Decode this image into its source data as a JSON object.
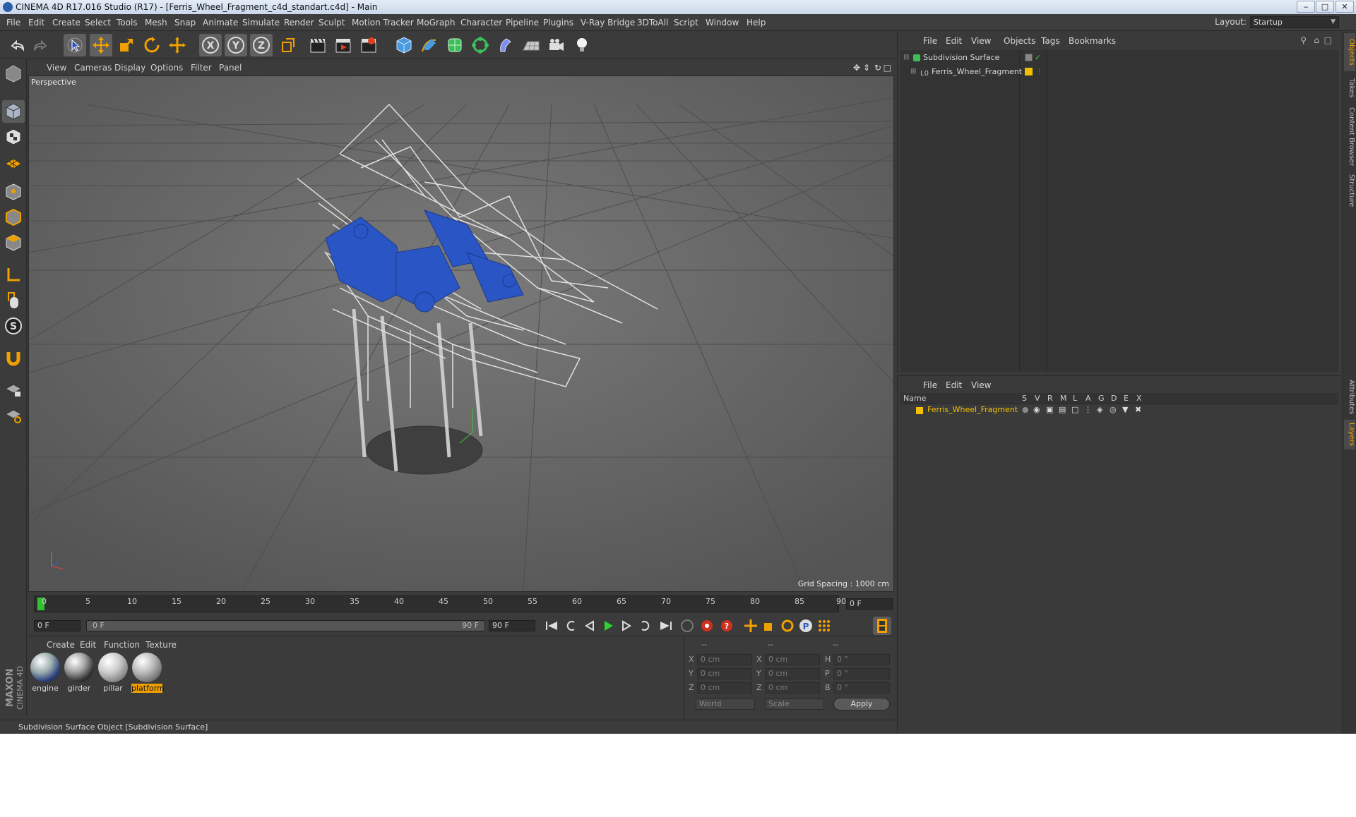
{
  "window": {
    "title": "CINEMA 4D R17.016 Studio (R17) - [Ferris_Wheel_Fragment_c4d_standart.c4d] - Main",
    "minimize": "‒",
    "maximize": "□",
    "close": "✕"
  },
  "menubar": {
    "items": [
      "File",
      "Edit",
      "Create",
      "Select",
      "Tools",
      "Mesh",
      "Snap",
      "Animate",
      "Simulate",
      "Render",
      "Sculpt",
      "Motion Tracker",
      "MoGraph",
      "Character",
      "Pipeline",
      "Plugins",
      "V-Ray Bridge",
      "3DToAll",
      "Script",
      "Window",
      "Help"
    ],
    "layout_label": "Layout:",
    "layout_value": "Startup"
  },
  "viewport": {
    "menu": [
      "View",
      "Cameras",
      "Display",
      "Options",
      "Filter",
      "Panel"
    ],
    "camera_label": "Perspective",
    "grid_spacing": "Grid Spacing : 1000 cm"
  },
  "timeline": {
    "ticks": [
      "0",
      "5",
      "10",
      "15",
      "20",
      "25",
      "30",
      "35",
      "40",
      "45",
      "50",
      "55",
      "60",
      "65",
      "70",
      "75",
      "80",
      "85",
      "90"
    ],
    "current_frame": "0 F",
    "start_field": "0 F",
    "range_start": "0 F",
    "range_end": "90 F",
    "end_field": "90 F"
  },
  "materials": {
    "menu": [
      "Create",
      "Edit",
      "Function",
      "Texture"
    ],
    "items": [
      {
        "name": "engine",
        "selected": false
      },
      {
        "name": "girder",
        "selected": false
      },
      {
        "name": "pillar",
        "selected": false
      },
      {
        "name": "platform",
        "selected": true
      }
    ]
  },
  "coordinates": {
    "headers": [
      "--",
      "--",
      "--"
    ],
    "rows": [
      {
        "a_label": "X",
        "a_value": "0 cm",
        "b_label": "X",
        "b_value": "0 cm",
        "c_label": "H",
        "c_value": "0 °"
      },
      {
        "a_label": "Y",
        "a_value": "0 cm",
        "b_label": "Y",
        "b_value": "0 cm",
        "c_label": "P",
        "c_value": "0 °"
      },
      {
        "a_label": "Z",
        "a_value": "0 cm",
        "b_label": "Z",
        "b_value": "0 cm",
        "c_label": "B",
        "c_value": "0 °"
      }
    ],
    "mode_world": "World",
    "mode_scale": "Scale",
    "apply": "Apply"
  },
  "statusbar": {
    "text": "Subdivision Surface Object [Subdivision Surface]"
  },
  "object_manager": {
    "menu": [
      "File",
      "Edit",
      "View",
      "Objects",
      "Tags",
      "Bookmarks"
    ],
    "objects": [
      {
        "name": "Subdivision Surface",
        "color": "#d8d8d8"
      },
      {
        "name": "Ferris_Wheel_Fragment",
        "color": "#d8d8d8"
      }
    ]
  },
  "layer_manager": {
    "menu": [
      "File",
      "Edit",
      "View"
    ],
    "columns": [
      "Name",
      "S",
      "V",
      "R",
      "M",
      "L",
      "A",
      "G",
      "D",
      "E",
      "X"
    ],
    "layers": [
      {
        "name": "Ferris_Wheel_Fragment",
        "color": "#f0c000"
      }
    ]
  },
  "right_tabs": [
    "Objects",
    "Takes",
    "Content Browser",
    "Structure",
    "Attributes",
    "Layers"
  ],
  "brand": {
    "maxon": "MAXON",
    "c4d": "CINEMA 4D"
  },
  "colors": {
    "accent": "#f0a000",
    "selection_blue": "#2a55c5",
    "viewport_bg": "#5e5e5e"
  }
}
